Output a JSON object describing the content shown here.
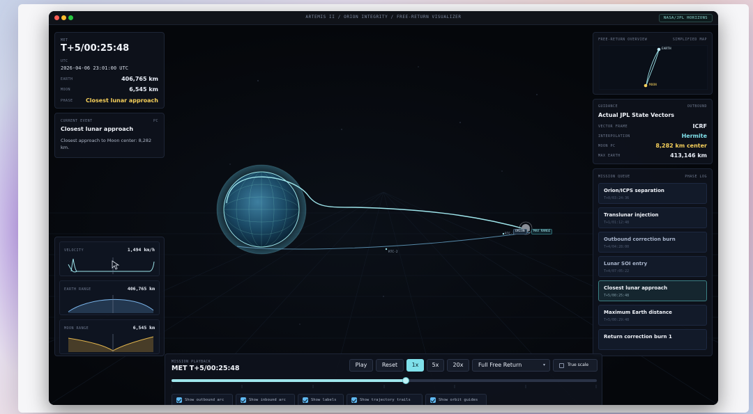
{
  "window": {
    "title": "ARTEMIS II / ORION INTEGRITY / FREE-RETURN VISUALIZER",
    "source_badge": "NASA/JPL HORIZONS"
  },
  "telemetry": {
    "met_label": "MET",
    "met_value": "T+5/00:25:48",
    "utc_label": "UTC",
    "utc_value": "2026-04-06 23:01:00 UTC",
    "rows": [
      {
        "label": "EARTH",
        "value": "406,765 km"
      },
      {
        "label": "MOON",
        "value": "6,545 km"
      },
      {
        "label": "PHASE",
        "value": "Closest lunar approach"
      }
    ],
    "phase_color": "#f5cf5a"
  },
  "current_event": {
    "label": "CURRENT EVENT",
    "tag": "PC",
    "title": "Closest lunar approach",
    "description": "Closest approach to Moon center: 8,282 km."
  },
  "mini_charts": [
    {
      "label": "VELOCITY",
      "value": "1,494 km/h",
      "color": "#9fe6ec"
    },
    {
      "label": "EARTH RANGE",
      "value": "406,765 km",
      "color": "#7ab3e8"
    },
    {
      "label": "MOON RANGE",
      "value": "6,545 km",
      "color": "#e3b64e"
    }
  ],
  "overview": {
    "label": "FREE-RETURN OVERVIEW",
    "tag": "SIMPLIFIED MAP",
    "earth_label": "EARTH",
    "moon_label": "MOON"
  },
  "guidance": {
    "label": "GUIDANCE",
    "tag": "OUTBOUND",
    "title": "Actual JPL State Vectors",
    "rows": [
      {
        "label": "VECTOR FRAME",
        "value": "ICRF"
      },
      {
        "label": "INTERPOLATION",
        "value": "Hermite"
      },
      {
        "label": "MOON PC",
        "value": "8,282 km center"
      },
      {
        "label": "MAX EARTH",
        "value": "413,146 km"
      }
    ],
    "interp_color": "#7fe0ea",
    "moonpc_color": "#f5cf5a"
  },
  "queue": {
    "label": "MISSION QUEUE",
    "tag": "PHASE LOG",
    "items": [
      {
        "title": "Orion/ICPS separation",
        "time": "T+0/03:24:36"
      },
      {
        "title": "Translunar injection",
        "time": "T+1/01:12:48"
      },
      {
        "title": "Outbound correction burn",
        "time": "T+4/04:28:00"
      },
      {
        "title": "Lunar SOI entry",
        "time": "T+4/07:05:22"
      },
      {
        "title": "Closest lunar approach",
        "time": "T+5/00:25:48"
      },
      {
        "title": "Maximum Earth distance",
        "time": "T+5/00:29:48"
      },
      {
        "title": "Return correction burn 1",
        "time": ""
      }
    ]
  },
  "scene": {
    "label_rtc1": "RTC-1",
    "label_rtc2": "RTC-2",
    "label_orion": "ORION",
    "label_max": "MAX RANGE"
  },
  "playback": {
    "label": "MISSION PLAYBACK",
    "met": "MET T+5/00:25:48",
    "buttons": {
      "play": "Play",
      "reset": "Reset",
      "x1": "1x",
      "x5": "5x",
      "x20": "20x"
    },
    "mode": "Full Free Return",
    "true_scale": "True scale",
    "progress": 0.55,
    "toggles": [
      "Show outbound arc",
      "Show inbound arc",
      "Show labels",
      "Show trajectory trails",
      "Show orbit guides"
    ]
  }
}
